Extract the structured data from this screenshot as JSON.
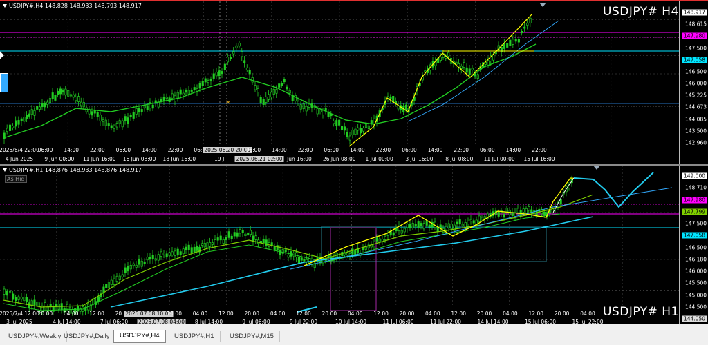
{
  "top_chart": {
    "info_line": "USDJPY#,H4  148.828 148.933 148.793 148.917",
    "title": "USDJPY# H4",
    "price_labels": [
      {
        "text": "148.917",
        "color": "#ffffff",
        "bg": "#ffffff",
        "boxed": true,
        "fg": "#000000"
      },
      {
        "text": "148.615",
        "color": "#ffffff",
        "boxed": false
      },
      {
        "text": "147.980",
        "color": "#000000",
        "bg": "#ff00ff",
        "boxed": true,
        "fg": "#000000"
      },
      {
        "text": "147.500",
        "color": "#ffffff",
        "boxed": false
      },
      {
        "text": "147.058",
        "color": "#000000",
        "bg": "#00e5ff",
        "boxed": true,
        "fg": "#000000"
      },
      {
        "text": "146.500",
        "color": "#ffffff",
        "boxed": false
      },
      {
        "text": "146.000",
        "color": "#ffffff",
        "boxed": false
      },
      {
        "text": "145.225",
        "color": "#ffffff",
        "boxed": false
      },
      {
        "text": "144.673",
        "color": "#ffffff",
        "boxed": false
      },
      {
        "text": "144.085",
        "color": "#ffffff",
        "boxed": false
      },
      {
        "text": "143.500",
        "color": "#ffffff",
        "boxed": false
      },
      {
        "text": "142.960",
        "color": "#ffffff",
        "boxed": false
      }
    ],
    "time_labels": [
      {
        "text": "2025/6/4 22:00",
        "hl": false
      },
      {
        "text": "06:00",
        "hl": false
      },
      {
        "text": "14:00",
        "hl": false
      },
      {
        "text": "22:00",
        "hl": false
      },
      {
        "text": "06:00",
        "hl": false
      },
      {
        "text": "14:00",
        "hl": false
      },
      {
        "text": "22:00",
        "hl": false
      },
      {
        "text": "06:00",
        "hl": false
      },
      {
        "text": "2025.06.20 20:00",
        "hl": true
      },
      {
        "text": "06:00",
        "hl": false
      },
      {
        "text": "14:00",
        "hl": false
      },
      {
        "text": "22:00",
        "hl": false
      },
      {
        "text": "06:00",
        "hl": false
      },
      {
        "text": "14:00",
        "hl": false
      },
      {
        "text": "22:00",
        "hl": false
      },
      {
        "text": "06:00",
        "hl": false
      },
      {
        "text": "14:00",
        "hl": false
      },
      {
        "text": "22:00",
        "hl": false
      },
      {
        "text": "06:00",
        "hl": false
      },
      {
        "text": "14:00",
        "hl": false
      },
      {
        "text": "22:00",
        "hl": false
      }
    ],
    "date_labels": [
      {
        "text": "4 Jun 2025"
      },
      {
        "text": "9 Jun 00:00"
      },
      {
        "text": "11 Jun 16:00"
      },
      {
        "text": "16 Jun 08:00"
      },
      {
        "text": "18 Jun 16:00"
      },
      {
        "text": "19 J"
      },
      {
        "text": "2025.06.21 02:00",
        "hl": true
      },
      {
        "text": "Jun 16:00"
      },
      {
        "text": "26 Jun 08:00"
      },
      {
        "text": "1 Jul 00:00"
      },
      {
        "text": "3 Jul 16:00"
      },
      {
        "text": "8 Jul 08:00"
      },
      {
        "text": "11 Jul 00:00"
      },
      {
        "text": "15 Jul 16:00"
      }
    ]
  },
  "bottom_chart": {
    "info_line": "USDJPY#,H1  148.876 148.933 148.876 148.917",
    "title": "USDJPY# H1",
    "overlay_button": "As Hid",
    "price_labels": [
      {
        "text": "149.000",
        "boxed": true,
        "bg": "#ffffff",
        "fg": "#000000"
      },
      {
        "text": "148.710",
        "boxed": false
      },
      {
        "text": "147.980",
        "boxed": true,
        "bg": "#ff00ff",
        "fg": "#000000"
      },
      {
        "text": "147.799",
        "boxed": true,
        "bg": "#7fd000",
        "fg": "#000000"
      },
      {
        "text": "147.500",
        "boxed": false
      },
      {
        "text": "147.058",
        "boxed": true,
        "bg": "#00e5ff",
        "fg": "#000000"
      },
      {
        "text": "146.500",
        "boxed": false
      },
      {
        "text": "146.180",
        "boxed": false
      },
      {
        "text": "146.000",
        "boxed": false
      },
      {
        "text": "145.500",
        "boxed": false
      },
      {
        "text": "145.000",
        "boxed": false
      },
      {
        "text": "144.500",
        "boxed": false
      },
      {
        "text": "144.050",
        "boxed": true,
        "bg": "#dddddd",
        "fg": "#000000"
      }
    ],
    "time_labels": [
      {
        "text": "2025/7/4 12:00",
        "hl": false
      },
      {
        "text": "20:00",
        "hl": false
      },
      {
        "text": "04:00",
        "hl": false
      },
      {
        "text": "12:00",
        "hl": false
      },
      {
        "text": "20:00",
        "hl": false
      },
      {
        "text": "2025.07.08 10:00",
        "hl": true
      },
      {
        "text": "20:00",
        "hl": false
      },
      {
        "text": "04:00",
        "hl": false
      },
      {
        "text": "12:00",
        "hl": false
      },
      {
        "text": "20:00",
        "hl": false
      },
      {
        "text": "04:00",
        "hl": false
      },
      {
        "text": "12:00",
        "hl": false
      },
      {
        "text": "20:00",
        "hl": false
      },
      {
        "text": "04:00",
        "hl": false
      },
      {
        "text": "12:00",
        "hl": false
      },
      {
        "text": "20:00",
        "hl": false
      },
      {
        "text": "04:00",
        "hl": false
      },
      {
        "text": "12:00",
        "hl": false
      },
      {
        "text": "20:00",
        "hl": false
      },
      {
        "text": "04:00",
        "hl": false
      },
      {
        "text": "12:00",
        "hl": false
      },
      {
        "text": "20:00",
        "hl": false
      },
      {
        "text": "04:00",
        "hl": false
      }
    ],
    "date_labels": [
      {
        "text": "3 Jul 2025"
      },
      {
        "text": "4 Jul 14:00"
      },
      {
        "text": "7 Jul 06:00"
      },
      {
        "text": "2025.07.08 04:00",
        "hl": true
      },
      {
        "text": "8 Jul 14:00"
      },
      {
        "text": "9 Jul 06:00"
      },
      {
        "text": "9 Jul 22:00"
      },
      {
        "text": "10 Jul 14:00"
      },
      {
        "text": "11 Jul 06:00"
      },
      {
        "text": "11 Jul 22:00"
      },
      {
        "text": "14 Jul 14:00"
      },
      {
        "text": "15 Jul 06:00"
      },
      {
        "text": "15 Jul 22:00"
      }
    ]
  },
  "tabs": [
    {
      "label": "USDJPY#,Weekly",
      "active": false
    },
    {
      "label": "USDJPY#,Daily",
      "active": false
    },
    {
      "label": "USDJPY#,H4",
      "active": true
    },
    {
      "label": "USDJPY#,H1",
      "active": false
    },
    {
      "label": "USDJPY#,M15",
      "active": false
    }
  ],
  "colors": {
    "magenta_level": "#ff00ff",
    "cyan_level": "#00e5ff",
    "ma_fast": "#22cc22",
    "ma_slow": "#7fd000",
    "zigzag": "#ffff00",
    "trend": "#33aaff",
    "projection": "#22ccee"
  }
}
